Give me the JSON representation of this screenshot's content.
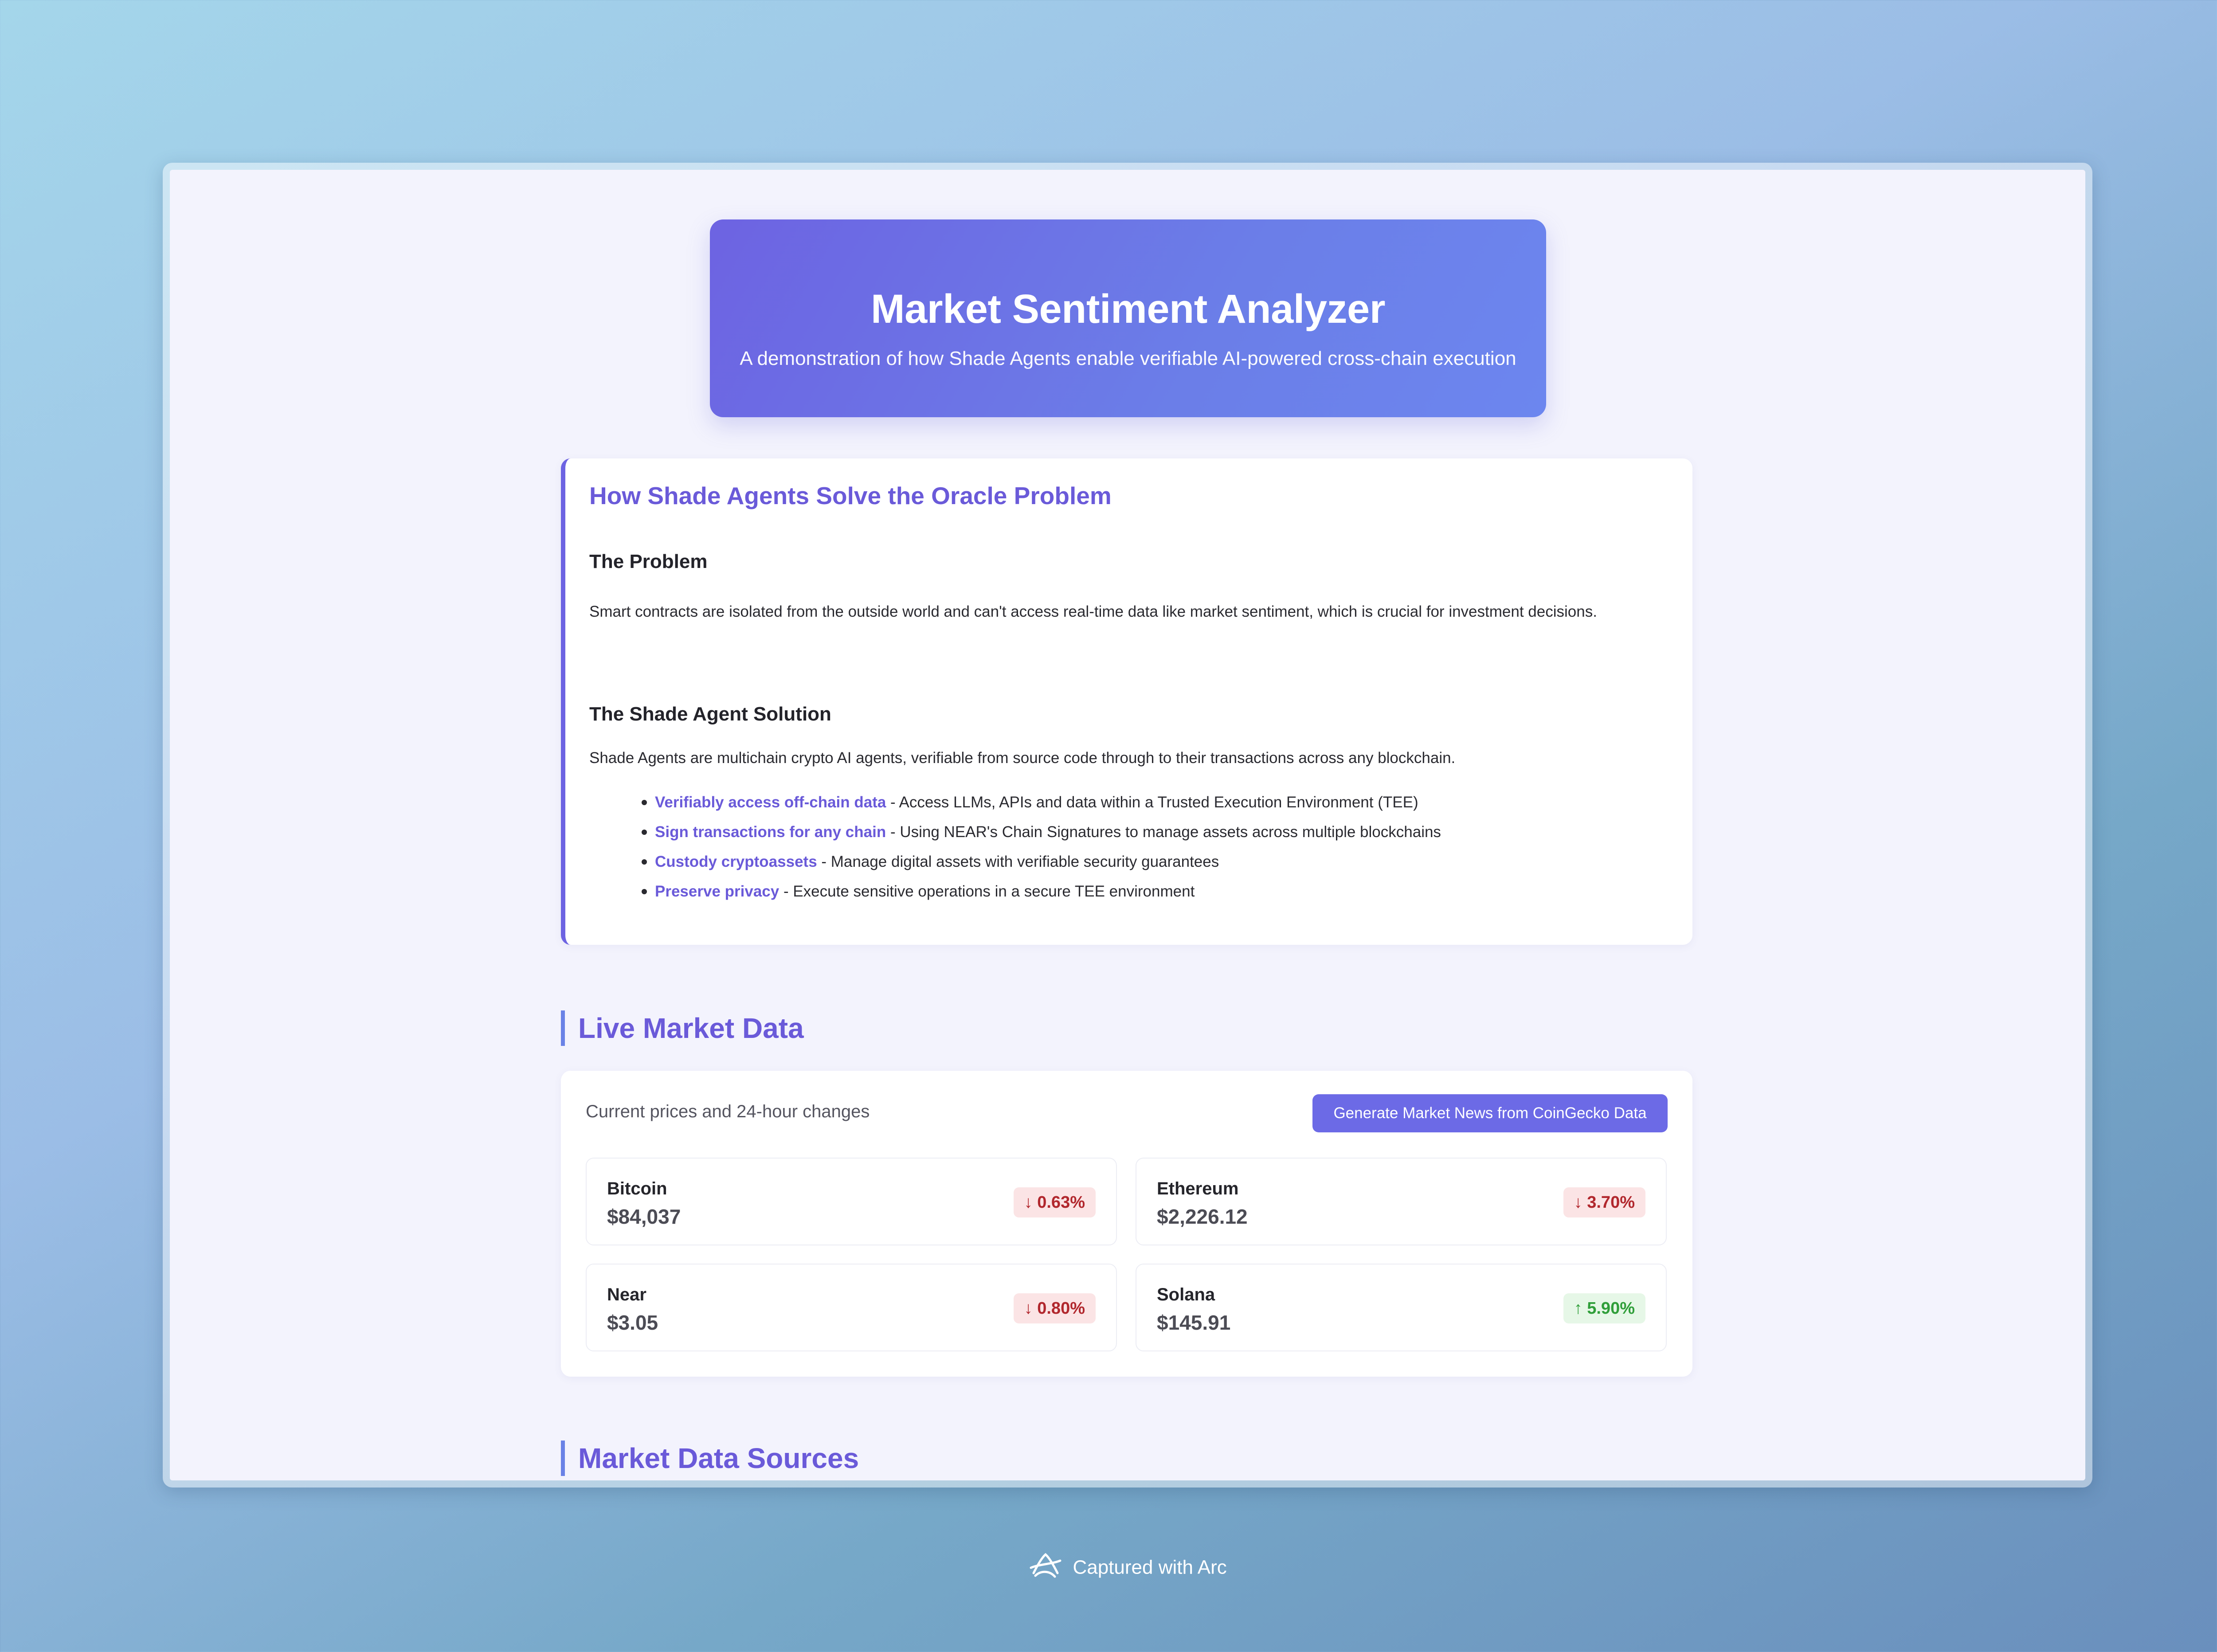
{
  "hero": {
    "title": "Market Sentiment Analyzer",
    "subtitle": "A demonstration of how Shade Agents enable verifiable AI-powered cross-chain execution"
  },
  "explainer": {
    "title": "How Shade Agents Solve the Oracle Problem",
    "problem_heading": "The Problem",
    "problem_text": "Smart contracts are isolated from the outside world and can't access real-time data like market sentiment, which is crucial for investment decisions.",
    "solution_heading": "The Shade Agent Solution",
    "solution_text": "Shade Agents are multichain crypto AI agents, verifiable from source code through to their transactions across any blockchain.",
    "features": [
      {
        "highlight": "Verifiably access off-chain data",
        "text": " - Access LLMs, APIs and data within a Trusted Execution Environment (TEE)"
      },
      {
        "highlight": "Sign transactions for any chain",
        "text": " - Using NEAR's Chain Signatures to manage assets across multiple blockchains"
      },
      {
        "highlight": "Custody cryptoassets",
        "text": " - Manage digital assets with verifiable security guarantees"
      },
      {
        "highlight": "Preserve privacy",
        "text": " - Execute sensitive operations in a secure TEE environment"
      }
    ]
  },
  "live_market": {
    "title": "Live Market Data",
    "description": "Current prices and 24-hour changes",
    "button_label": "Generate Market News from CoinGecko Data",
    "coins": [
      {
        "name": "Bitcoin",
        "price": "$84,037",
        "change": "↓ 0.63%",
        "direction": "down"
      },
      {
        "name": "Ethereum",
        "price": "$2,226.12",
        "change": "↓ 3.70%",
        "direction": "down"
      },
      {
        "name": "Near",
        "price": "$3.05",
        "change": "↓ 0.80%",
        "direction": "down"
      },
      {
        "name": "Solana",
        "price": "$145.91",
        "change": "↑ 5.90%",
        "direction": "up"
      }
    ]
  },
  "sources": {
    "title": "Market Data Sources"
  },
  "footer": {
    "label": "Captured with Arc",
    "icon": "arc-logo-icon"
  },
  "colors": {
    "accent": "#6a5ad9",
    "down_bg": "#fbe4e5",
    "down_text": "#b1272d",
    "up_bg": "#e6f7e7",
    "up_text": "#2f9e39"
  }
}
